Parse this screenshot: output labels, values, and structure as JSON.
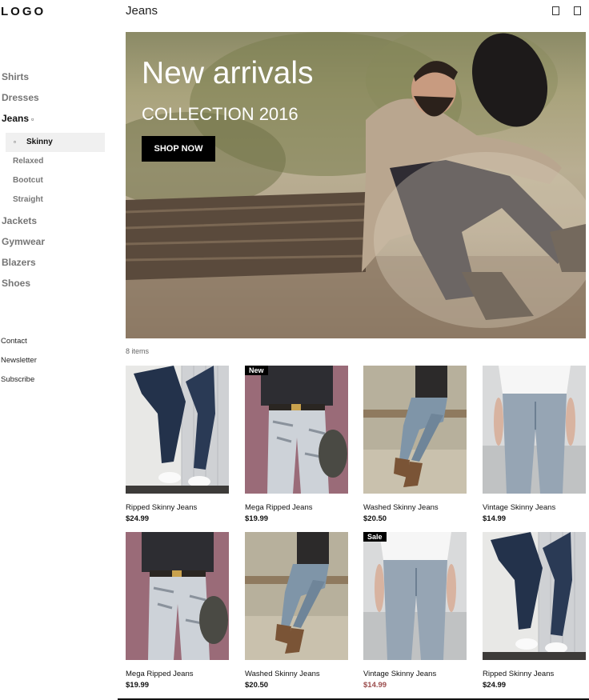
{
  "sidebar": {
    "logo": "LOGO",
    "nav": [
      {
        "label": "Shirts"
      },
      {
        "label": "Dresses"
      },
      {
        "label": "Jeans",
        "icon": "chevron-down-icon"
      },
      {
        "label": "Jackets"
      },
      {
        "label": "Gymwear"
      },
      {
        "label": "Blazers"
      },
      {
        "label": "Shoes"
      }
    ],
    "jeans_sub": [
      "Skinny",
      "Relaxed",
      "Bootcut",
      "Straight"
    ],
    "footer_links": [
      "Contact",
      "Newsletter",
      "Subscribe"
    ]
  },
  "header": {
    "title": "Jeans",
    "icons": [
      "cart-icon",
      "search-icon"
    ]
  },
  "hero": {
    "title": "New arrivals",
    "subtitle": "COLLECTION 2016",
    "button": "SHOP NOW"
  },
  "listing": {
    "count": "8 items"
  },
  "products": [
    {
      "name": "Ripped Skinny Jeans",
      "price": "$24.99",
      "badge": ""
    },
    {
      "name": "Mega Ripped Jeans",
      "price": "$19.99",
      "badge": "New"
    },
    {
      "name": "Washed Skinny Jeans",
      "price": "$20.50",
      "badge": ""
    },
    {
      "name": "Vintage Skinny Jeans",
      "price": "$14.99",
      "badge": ""
    },
    {
      "name": "Mega Ripped Jeans",
      "price": "$19.99",
      "badge": ""
    },
    {
      "name": "Washed Skinny Jeans",
      "price": "$20.50",
      "badge": ""
    },
    {
      "name": "Vintage Skinny Jeans",
      "price": "$14.99",
      "badge": "Sale"
    },
    {
      "name": "Ripped Skinny Jeans",
      "price": "$24.99",
      "badge": ""
    }
  ],
  "colors": {
    "sale_price": "#9b4d4d",
    "accent": "#000000"
  }
}
